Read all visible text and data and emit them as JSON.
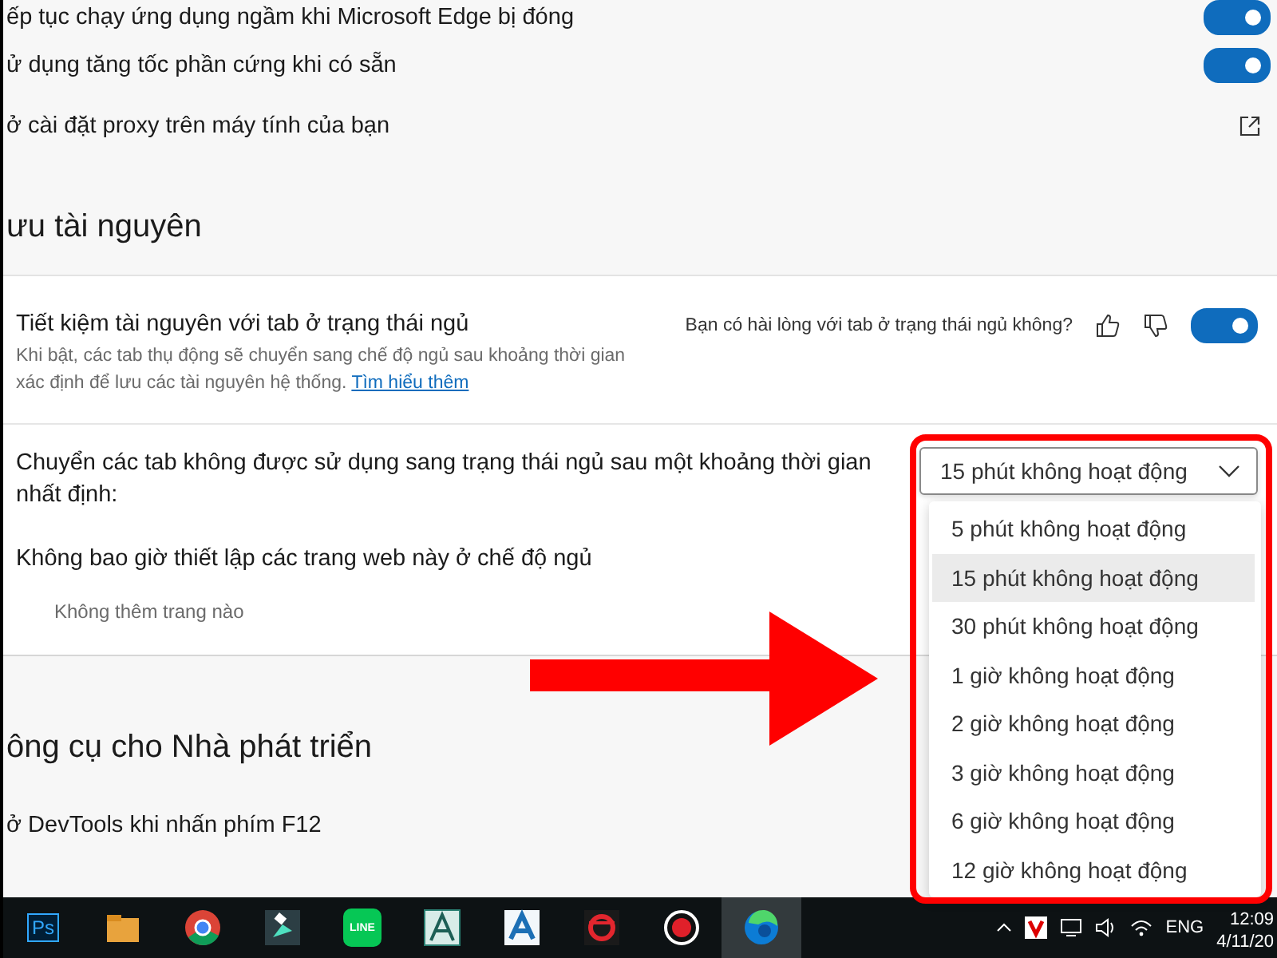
{
  "top_settings": [
    {
      "label": "ếp tục chạy ứng dụng ngầm khi Microsoft Edge bị đóng",
      "kind": "toggle",
      "on": true
    },
    {
      "label": "ử dụng tăng tốc phần cứng khi có sẵn",
      "kind": "toggle",
      "on": true
    },
    {
      "label": "ở cài đặt proxy trên máy tính của bạn",
      "kind": "external"
    }
  ],
  "resource_section": {
    "heading": "ưu tài nguyên",
    "sleeping_tabs": {
      "title": "Tiết kiệm tài nguyên với tab ở trạng thái ngủ",
      "description": "Khi bật, các tab thụ động sẽ chuyển sang chế độ ngủ sau khoảng thời gian xác định để lưu các tài nguyên hệ thống.",
      "link": "Tìm hiểu thêm",
      "feedback": "Bạn có hài lòng với tab ở trạng thái ngủ không?",
      "on": true
    },
    "timeout": {
      "label": "Chuyển các tab không được sử dụng sang trạng thái ngủ sau một khoảng thời gian nhất định:",
      "dropdown": {
        "value": "15 phút không hoạt động",
        "expanded": true,
        "options": [
          {
            "label": "5 phút không hoạt động",
            "selected": false
          },
          {
            "label": "15 phút không hoạt động",
            "selected": true
          },
          {
            "label": "30 phút không hoạt động",
            "selected": false
          },
          {
            "label": "1 giờ không hoạt động",
            "selected": false
          },
          {
            "label": "2 giờ không hoạt động",
            "selected": false
          },
          {
            "label": "3 giờ không hoạt động",
            "selected": false
          },
          {
            "label": "6 giờ không hoạt động",
            "selected": false
          },
          {
            "label": "12 giờ không hoạt động",
            "selected": false
          }
        ]
      }
    },
    "never_sleep": {
      "title": "Không bao giờ thiết lập các trang web này ở chế độ ngủ",
      "empty_text": "Không thêm trang nào"
    }
  },
  "developer_section": {
    "heading": "ông cụ cho Nhà phát triển",
    "items": [
      {
        "label": "ở DevTools khi nhấn phím F12"
      }
    ]
  },
  "taskbar": {
    "apps": [
      {
        "kind": "photoshop",
        "label": "Ps",
        "active": false
      },
      {
        "kind": "folder",
        "active": false
      },
      {
        "kind": "chrome",
        "active": false
      },
      {
        "kind": "filmora",
        "active": false
      },
      {
        "kind": "line",
        "label": "LINE",
        "active": false
      },
      {
        "kind": "tool",
        "active": false
      },
      {
        "kind": "autocad",
        "active": false
      },
      {
        "kind": "garena",
        "active": false
      },
      {
        "kind": "record",
        "active": false
      },
      {
        "kind": "edge",
        "active": true
      }
    ],
    "tray": {
      "language": "ENG",
      "time": "12:09",
      "date": "4/11/20"
    }
  }
}
